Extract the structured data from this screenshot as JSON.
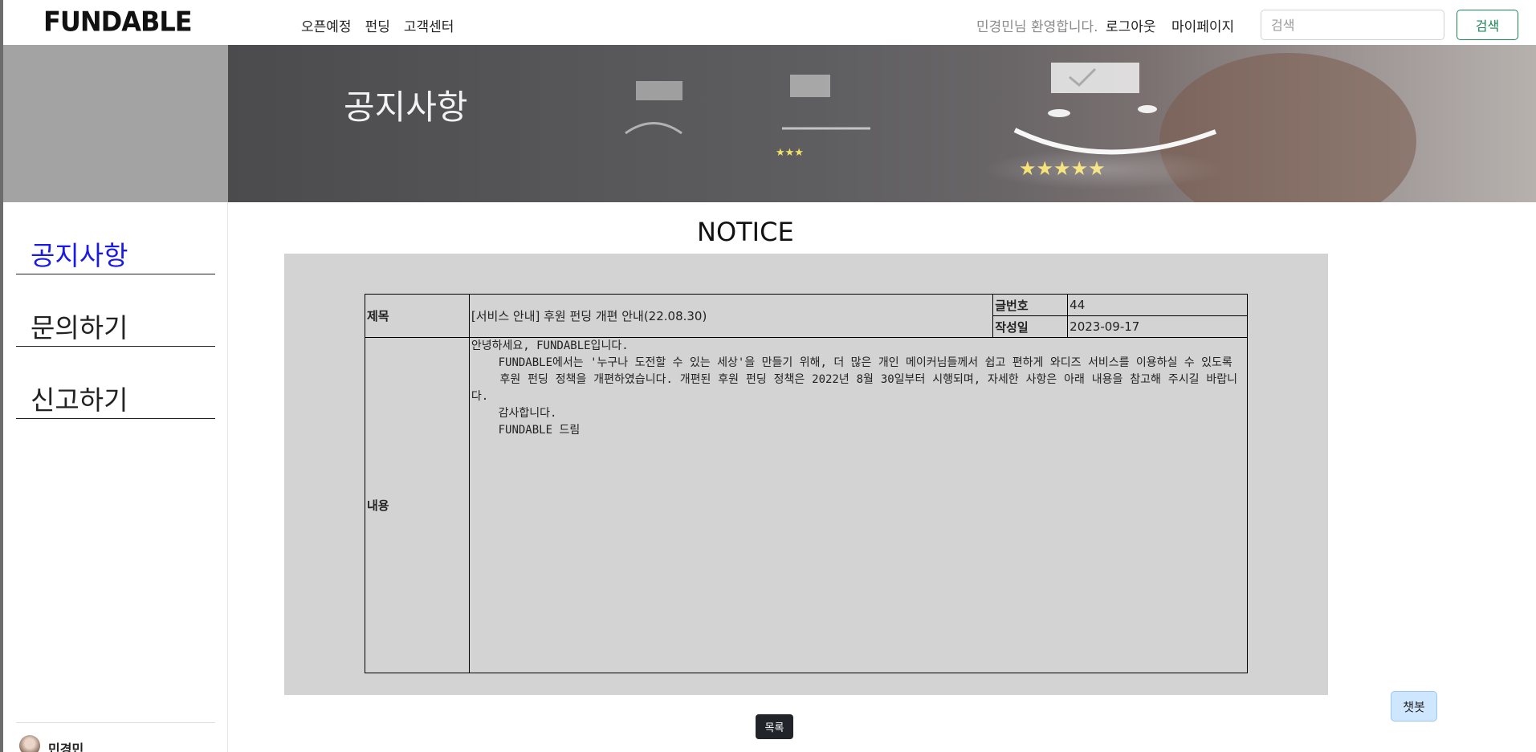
{
  "header": {
    "logo": "FUNDABLE",
    "menu": [
      "오픈예정",
      "펀딩",
      "고객센터"
    ],
    "welcome": "민경민님 환영합니다.",
    "logout": "로그아웃",
    "mypage": "마이페이지",
    "search_placeholder": "검색",
    "search_button": "검색"
  },
  "banner": {
    "title": "공지사항"
  },
  "sidebar": {
    "items": [
      {
        "label": "공지사항",
        "active": true
      },
      {
        "label": "문의하기",
        "active": false
      },
      {
        "label": "신고하기",
        "active": false
      }
    ],
    "profile_name": "민경민"
  },
  "main": {
    "heading": "NOTICE",
    "labels": {
      "title": "제목",
      "post_no": "글번호",
      "date": "작성일",
      "content": "내용"
    },
    "post": {
      "title": "[서비스 안내] 후원 펀딩 개편 안내(22.08.30)",
      "post_no": "44",
      "date": "2023-09-17",
      "content_lines": [
        "안녕하세요, FUNDABLE입니다.",
        "",
        "    FUNDABLE에서는 '누구나 도전할 수 있는 세상'을 만들기 위해, 더 많은 개인 메이커님들께서 쉽고 편하게 와디즈 서비스를 이용하실 수 있도록",
        "    후원 펀딩 정책을 개편하였습니다. 개편된 후원 펀딩 정책은 2022년 8월 30일부터 시행되며, 자세한 사항은 아래 내용을 참고해 주시길 바랍니다.",
        "",
        "    감사합니다.",
        "    FUNDABLE 드림"
      ]
    },
    "list_button": "목록",
    "chatbot_button": "챗봇"
  },
  "colors": {
    "active_link": "#1a1ae6",
    "search_button": "#198754",
    "panel": "#d3d3d3"
  }
}
